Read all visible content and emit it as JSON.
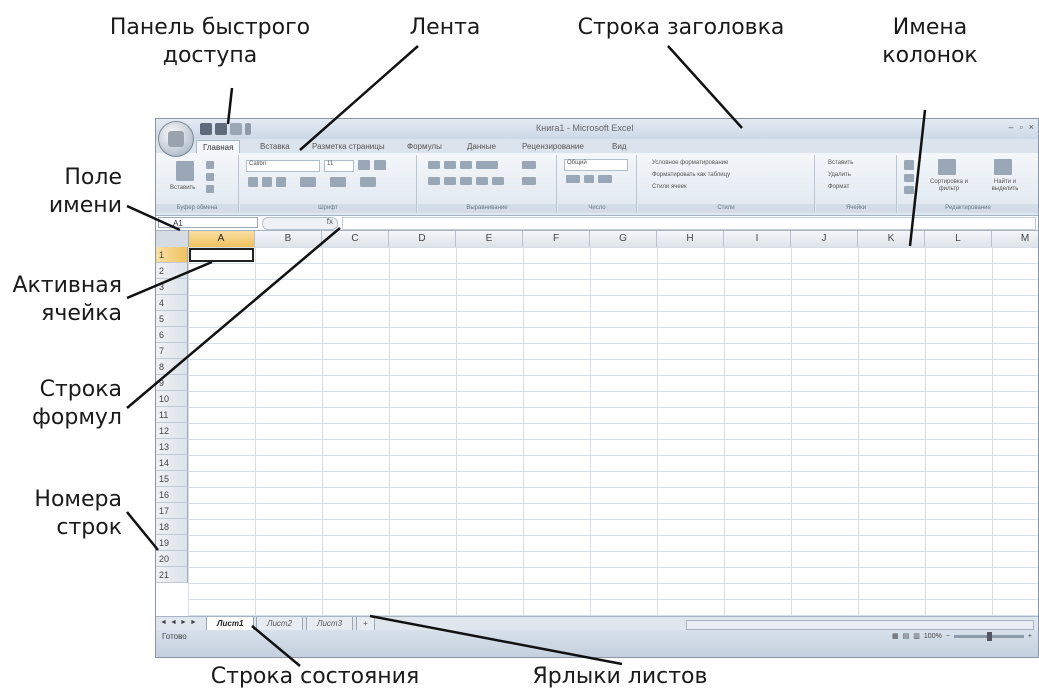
{
  "callouts": {
    "qat": "Панель быстрого\nдоступа",
    "ribbon": "Лента",
    "title_bar": "Строка заголовка",
    "column_names": "Имена\nколонок",
    "name_box": "Поле\nимени",
    "active_cell": "Активная\nячейка",
    "formula_bar": "Строка\nформул",
    "row_numbers": "Номера\nстрок",
    "status_bar": "Строка состояния",
    "sheet_tabs": "Ярлыки листов"
  },
  "window": {
    "title": "Книга1 - Microsoft Excel",
    "controls": [
      "–",
      "▫",
      "×"
    ]
  },
  "tabs": [
    "Главная",
    "Вставка",
    "Разметка страницы",
    "Формулы",
    "Данные",
    "Рецензирование",
    "Вид"
  ],
  "ribbon": {
    "clipboard": {
      "label": "Буфер обмена",
      "paste": "Вставить"
    },
    "font": {
      "label": "Шрифт",
      "name": "Calibri",
      "size": "11"
    },
    "alignment": {
      "label": "Выравнивание"
    },
    "number": {
      "label": "Число",
      "format": "Общий"
    },
    "styles": {
      "label": "Стили",
      "items": [
        "Условное форматирование",
        "Форматировать как таблицу",
        "Стили ячеек"
      ]
    },
    "cells": {
      "label": "Ячейки",
      "items": [
        "Вставить",
        "Удалить",
        "Формат"
      ]
    },
    "editing": {
      "label": "Редактирование",
      "sort": "Сортировка и фильтр",
      "find": "Найти и выделить"
    }
  },
  "formula_bar": {
    "name_box": "A1",
    "fx": "fx",
    "value": ""
  },
  "columns": [
    "A",
    "B",
    "C",
    "D",
    "E",
    "F",
    "G",
    "H",
    "I",
    "J",
    "K",
    "L",
    "M"
  ],
  "rows": [
    "1",
    "2",
    "3",
    "4",
    "5",
    "6",
    "7",
    "8",
    "9",
    "10",
    "11",
    "12",
    "13",
    "14",
    "15",
    "16",
    "17",
    "18",
    "19",
    "20",
    "21"
  ],
  "active_cell": "A1",
  "sheets": [
    "Лист1",
    "Лист2",
    "Лист3"
  ],
  "status": {
    "text": "Готово",
    "zoom": "100%"
  }
}
